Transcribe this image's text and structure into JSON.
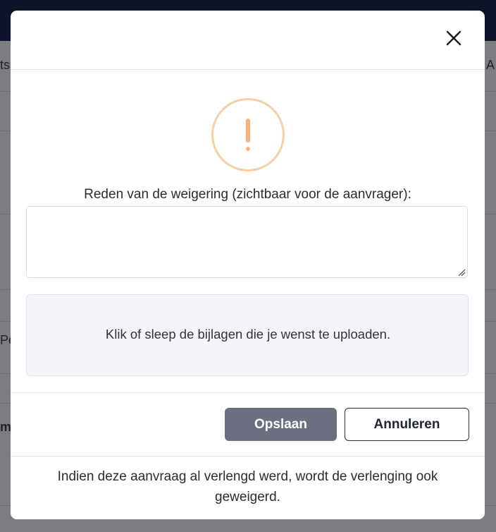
{
  "background": {
    "fragments": [
      "ts",
      "A",
      "Pe",
      "m"
    ]
  },
  "dialog": {
    "close_icon": "close-icon",
    "warning_icon": "exclamation-circle-icon",
    "warning_color": "#f6b27a",
    "reason_label": "Reden van de weigering (zichtbaar voor de aanvrager):",
    "reason_value": "",
    "dropzone_text": "Klik of sleep de bijlagen die je wenst te uploaden.",
    "buttons": {
      "save_label": "Opslaan",
      "cancel_label": "Annuleren"
    },
    "footer_note": "Indien deze aanvraag al verlengd werd, wordt de verlenging ook geweigerd."
  },
  "colors": {
    "topbar": "#0d1328",
    "save_button": "#6c6f7f",
    "dropzone_bg": "#f3f5fa"
  }
}
